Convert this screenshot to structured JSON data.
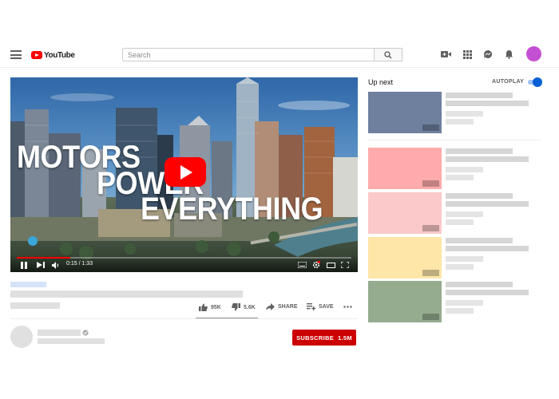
{
  "header": {
    "logo_text": "YouTube",
    "search_placeholder": "Search",
    "icons": [
      "menu-icon",
      "youtube-logo-icon",
      "search-icon",
      "create-video-icon",
      "apps-grid-icon",
      "messages-icon",
      "notifications-bell-icon",
      "avatar"
    ],
    "avatar_color": "#c54fd2"
  },
  "player": {
    "overlay_line1": "MOTORS",
    "overlay_line2": "POWER",
    "overlay_line3": "EVERYTHING",
    "time_display": "0:15 / 1:33",
    "progress_fraction": 0.16,
    "accent_color": "#ff0000"
  },
  "video_actions": {
    "likes": "95K",
    "dislikes": "5.6K",
    "share_label": "SHARE",
    "save_label": "SAVE",
    "more_icon": "more-horizontal-icon"
  },
  "channel": {
    "subscribe_label": "SUBSCRIBE",
    "subscriber_count": "1.5M",
    "subscribe_color": "#cc0000"
  },
  "sidebar": {
    "up_next_label": "Up next",
    "autoplay_label": "AUTOPLAY",
    "autoplay_on": true,
    "recommendations": [
      {
        "thumb_color": "#6f7f9e"
      },
      {
        "thumb_color": "#ffabab"
      },
      {
        "thumb_color": "#fbc9c9"
      },
      {
        "thumb_color": "#fde6a8"
      },
      {
        "thumb_color": "#95ac8f"
      }
    ]
  }
}
